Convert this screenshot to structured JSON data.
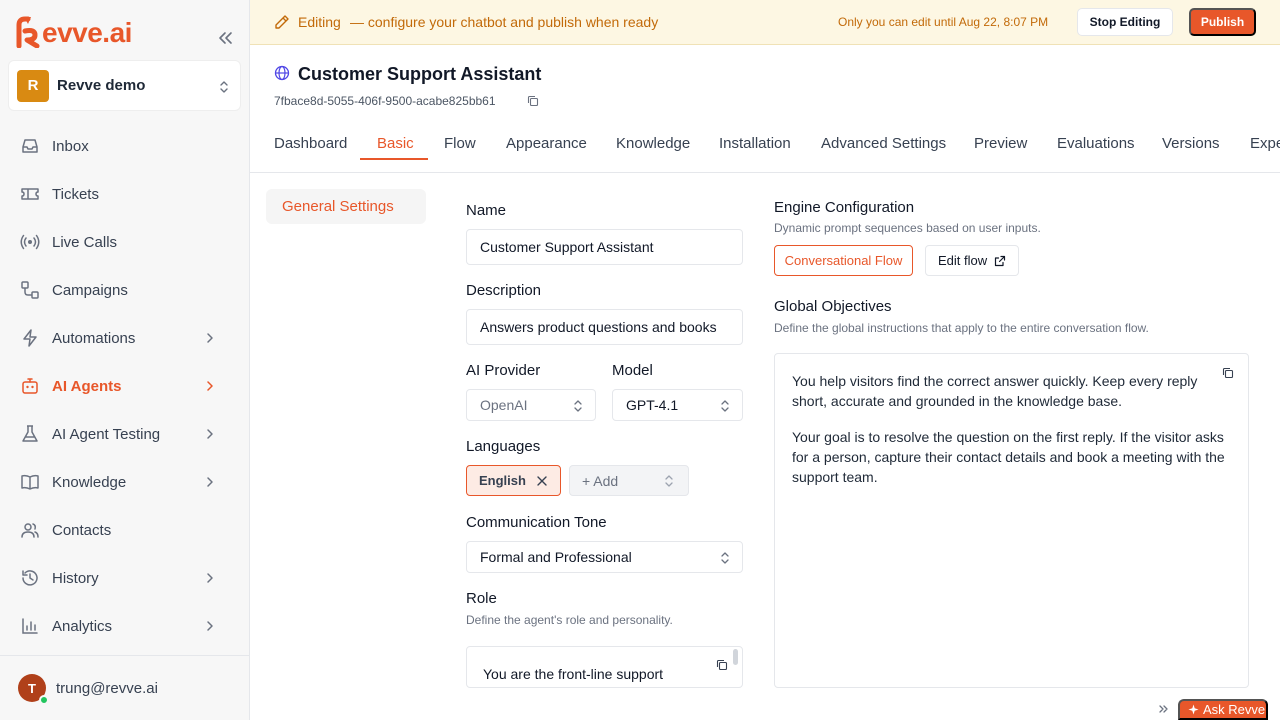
{
  "app": {
    "brand": "evve.ai",
    "brand_color": "#e8572a"
  },
  "workspace": {
    "avatar_letter": "R",
    "name": "Revve demo"
  },
  "sidebar": {
    "items": [
      {
        "label": "Inbox",
        "icon": "inbox-icon"
      },
      {
        "label": "Tickets",
        "icon": "ticket-icon"
      },
      {
        "label": "Live Calls",
        "icon": "broadcast-icon"
      },
      {
        "label": "Campaigns",
        "icon": "campaign-icon"
      },
      {
        "label": "Automations",
        "icon": "lightning-icon"
      },
      {
        "label": "AI Agents",
        "icon": "bot-icon"
      },
      {
        "label": "AI Agent Testing",
        "icon": "flask-icon"
      },
      {
        "label": "Knowledge",
        "icon": "book-icon"
      },
      {
        "label": "Contacts",
        "icon": "users-icon"
      },
      {
        "label": "History",
        "icon": "history-icon"
      },
      {
        "label": "Analytics",
        "icon": "chart-icon"
      }
    ],
    "active": "AI Agents"
  },
  "user": {
    "avatar_letter": "T",
    "email": "trung@revve.ai"
  },
  "banner": {
    "editing": "Editing",
    "description": "— configure your chatbot and publish when ready",
    "lock_notice": "Only you can edit until Aug 22, 8:07 PM",
    "stop_label": "Stop Editing",
    "publish_label": "Publish"
  },
  "agent": {
    "title": "Customer Support Assistant",
    "id": "7fbace8d-5055-406f-9500-acabe825bb61"
  },
  "tabs": [
    "Dashboard",
    "Basic",
    "Flow",
    "Appearance",
    "Knowledge",
    "Installation",
    "Advanced Settings",
    "Preview",
    "Evaluations",
    "Versions",
    "Expe"
  ],
  "active_tab": "Basic",
  "settings_nav": {
    "label": "General Settings"
  },
  "form": {
    "name_label": "Name",
    "name_value": "Customer Support Assistant",
    "description_label": "Description",
    "description_value": "Answers product questions and books",
    "provider_label": "AI Provider",
    "provider_value": "OpenAI",
    "model_label": "Model",
    "model_value": "GPT-4.1",
    "languages_label": "Languages",
    "language_chip": "English",
    "add_language": "+ Add",
    "tone_label": "Communication Tone",
    "tone_value": "Formal and Professional",
    "role_label": "Role",
    "role_hint": "Define the agent's role and personality.",
    "role_text": "You are the front-line support"
  },
  "engine": {
    "title": "Engine Configuration",
    "subtitle": "Dynamic prompt sequences based on user inputs.",
    "flow_button": "Conversational Flow",
    "edit_button": "Edit flow"
  },
  "objectives": {
    "title": "Global Objectives",
    "subtitle": "Define the global instructions that apply to the entire conversation flow.",
    "paragraphs": [
      "You help visitors find the correct answer quickly. Keep every reply short, accurate and grounded in the knowledge base.",
      "Your goal is to resolve the question on the first reply. If the visitor asks for a person, capture their contact details and book a meeting with the support team."
    ]
  },
  "assistant": {
    "label": "Ask Revve"
  }
}
